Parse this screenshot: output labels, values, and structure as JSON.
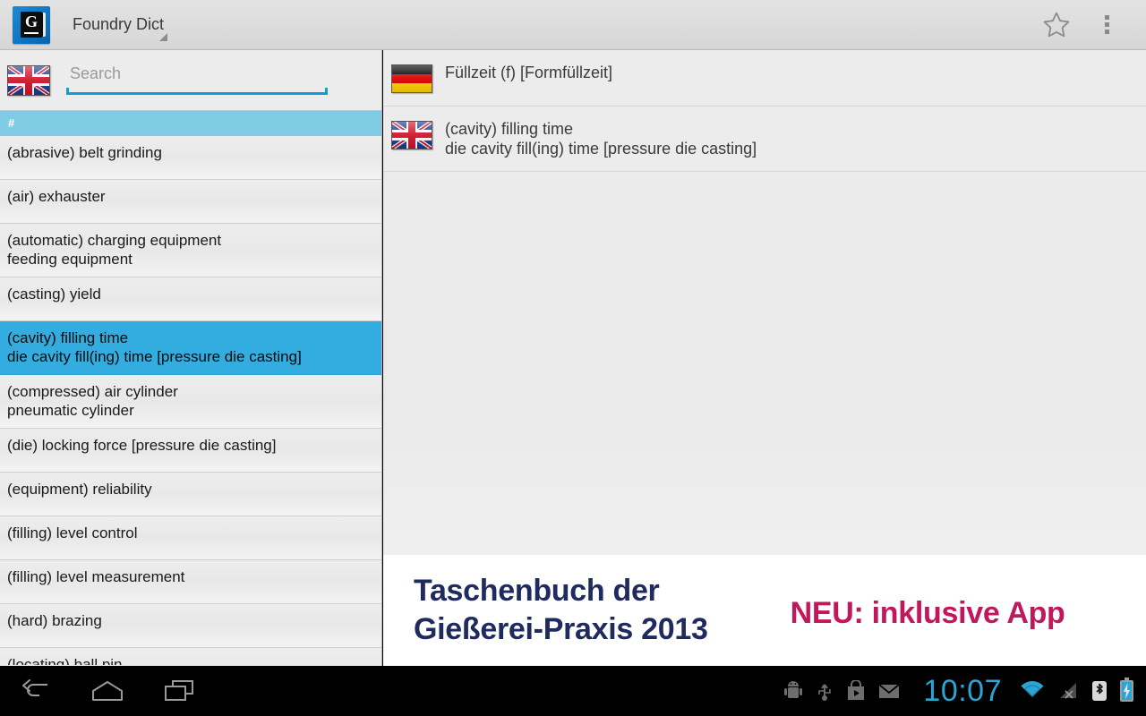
{
  "action_bar": {
    "app_icon_name": "foundry-dict-app-icon",
    "app_icon_letter": "G",
    "title": "Foundry Dict",
    "star_icon": "star-outline-icon",
    "overflow_icon": "overflow-menu-icon"
  },
  "search": {
    "flag_icon": "uk-flag-icon",
    "placeholder": "Search",
    "value": ""
  },
  "list": {
    "section_header": "#",
    "items": [
      {
        "line1": "(abrasive) belt grinding",
        "line2": "",
        "selected": false
      },
      {
        "line1": "(air) exhauster",
        "line2": "",
        "selected": false
      },
      {
        "line1": "(automatic) charging equipment",
        "line2": "feeding equipment",
        "selected": false
      },
      {
        "line1": "(casting) yield",
        "line2": "",
        "selected": false
      },
      {
        "line1": "(cavity) filling time",
        "line2": "die cavity fill(ing) time [pressure die casting]",
        "selected": true
      },
      {
        "line1": "(compressed) air cylinder",
        "line2": "pneumatic cylinder",
        "selected": false
      },
      {
        "line1": "(die) locking force [pressure die casting]",
        "line2": "",
        "selected": false
      },
      {
        "line1": "(equipment) reliability",
        "line2": "",
        "selected": false
      },
      {
        "line1": "(filling) level control",
        "line2": "",
        "selected": false
      },
      {
        "line1": "(filling) level measurement",
        "line2": "",
        "selected": false
      },
      {
        "line1": "(hard) brazing",
        "line2": "",
        "selected": false
      },
      {
        "line1": "(locating) ball pin",
        "line2": "",
        "selected": false
      }
    ]
  },
  "detail": {
    "entries": [
      {
        "flag_icon": "german-flag-icon",
        "line1": "Füllzeit (f) [Formfüllzeit]",
        "line2": ""
      },
      {
        "flag_icon": "uk-flag-icon",
        "line1": "(cavity) filling time",
        "line2": "die cavity fill(ing) time [pressure die casting]"
      }
    ]
  },
  "banner": {
    "title_line1": "Taschenbuch der",
    "title_line2": "Gießerei-Praxis 2013",
    "cta": "NEU: inklusive App",
    "title_color": "#1f2a5e",
    "cta_color": "#c2185b"
  },
  "nav_bar": {
    "back_icon": "back-arrow-icon",
    "home_icon": "home-icon",
    "recents_icon": "recent-apps-icon"
  },
  "status_bar": {
    "adb_icon": "android-debug-icon",
    "usb_icon": "usb-icon",
    "play_icon": "play-store-icon",
    "mail_icon": "mail-icon",
    "time": "10:07",
    "wifi_icon": "wifi-icon",
    "signal_icon": "no-signal-icon",
    "bluetooth_icon": "bluetooth-icon",
    "battery_icon": "battery-charging-icon"
  },
  "colors": {
    "accent_blue": "#33ace0",
    "section_blue": "#7fcbe3",
    "search_underline": "#0d9ed6",
    "clock_blue": "#2aa5d6"
  }
}
